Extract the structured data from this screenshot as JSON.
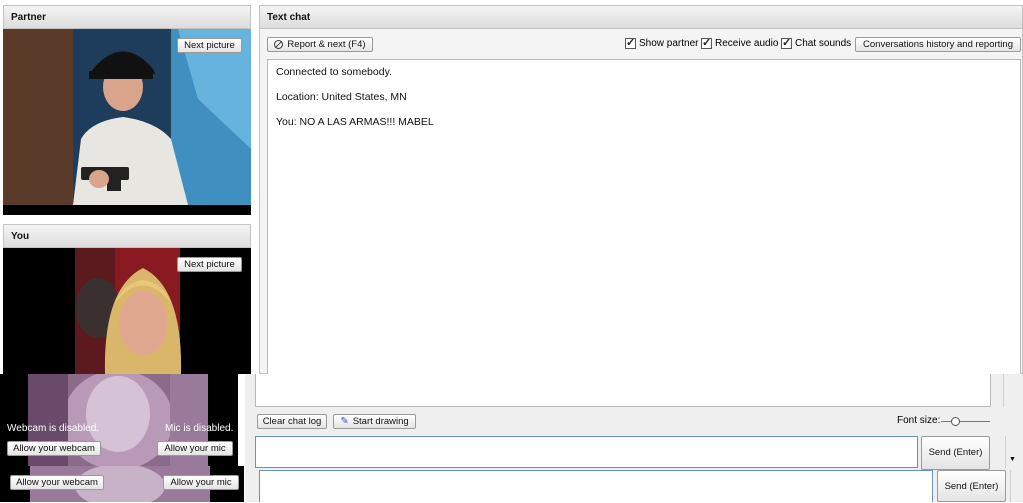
{
  "partner": {
    "title": "Partner",
    "next_picture_label": "Next picture"
  },
  "you": {
    "title": "You",
    "next_picture_label": "Next picture",
    "webcam_status": "Webcam is disabled.",
    "mic_status": "Mic is disabled.",
    "allow_webcam_label": "Allow your webcam",
    "allow_mic_label": "Allow your mic",
    "allow_webcam_label_2": "Allow your webcam",
    "allow_mic_label_2": "Allow your mic"
  },
  "text_chat": {
    "title": "Text chat",
    "report_next_label": "Report & next (F4)",
    "show_partner_label": "Show partner",
    "receive_audio_label": "Receive audio",
    "chat_sounds_label": "Chat sounds",
    "history_label": "Conversations history and reporting",
    "messages": [
      "Connected to somebody.",
      "Location: United States, MN",
      "You: NO A LAS ARMAS!!! MABEL"
    ],
    "clear_log_label": "Clear chat log",
    "start_drawing_label": "Start drawing",
    "font_size_label": "Font size:",
    "font_size_value": 0.25,
    "send_label": "Send (Enter)",
    "send_label_2": "Send (Enter)",
    "input_value": ""
  },
  "colors": {
    "accent_border": "#6a8fc7",
    "panel_bg": "#e8e8e8"
  }
}
